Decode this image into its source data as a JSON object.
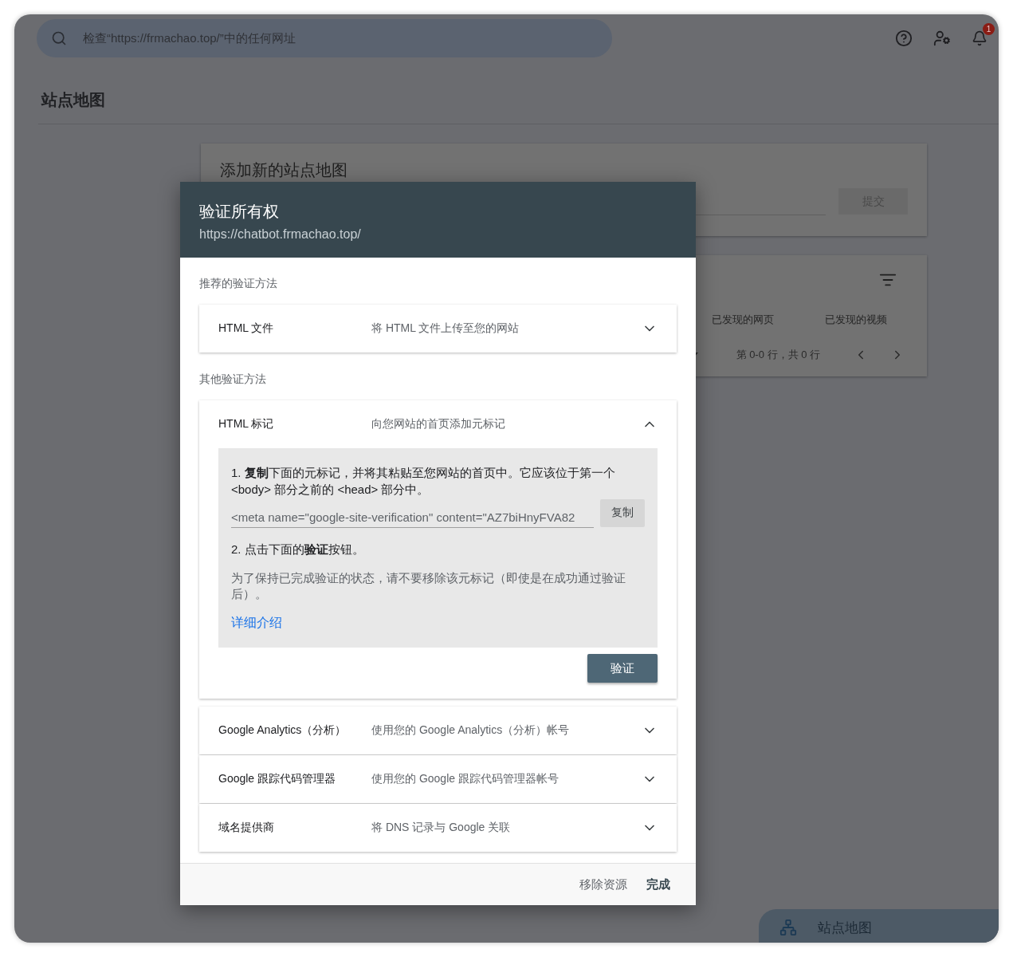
{
  "search": {
    "placeholder": "检查“https://frmachao.top/”中的任何网址"
  },
  "notification_count": "1",
  "page_title": "站点地图",
  "add_sitemap_card": {
    "title": "添加新的站点地图",
    "submit_button": "提交"
  },
  "sitemaps_table": {
    "columns": [
      "已发现的网页",
      "已发现的视频"
    ],
    "pagination": "第 0-0 行，共 0 行"
  },
  "floating_panel": {
    "label": "站点地图"
  },
  "dialog": {
    "title": "验证所有权",
    "url": "https://chatbot.frmachao.top/",
    "recommended_heading": "推荐的验证方法",
    "recommended_methods": [
      {
        "name": "HTML 文件",
        "description": "将 HTML 文件上传至您的网站",
        "expanded": false
      }
    ],
    "other_heading": "其他验证方法",
    "other_methods": [
      {
        "name": "HTML 标记",
        "description": "向您网站的首页添加元标记",
        "expanded": true,
        "details": {
          "step_1": "1. **复制**下面的元标记，并将其粘贴至您网站的首页中。它应该位于第一个 <body> 部分之前的 <head> 部分中。",
          "meta_tag": "<meta name=\"google-site-verification\" content=\"AZ7biHnyFVA82",
          "copy_button": "复制",
          "step_2": "2. 点击下面的**验证**按钮。",
          "note": "为了保持已完成验证的状态，请不要移除该元标记（即使是在成功通过验证后）。",
          "learn_more_link": "详细介绍",
          "verify_button": "验证"
        }
      },
      {
        "name": "Google Analytics（分析）",
        "description": "使用您的 Google Analytics（分析）帐号",
        "expanded": false
      },
      {
        "name": "Google 跟踪代码管理器",
        "description": "使用您的 Google 跟踪代码管理器帐号",
        "expanded": false
      },
      {
        "name": "域名提供商",
        "description": "将 DNS 记录与 Google 关联",
        "expanded": false
      }
    ],
    "footer_buttons": [
      "移除资源",
      "完成"
    ]
  }
}
